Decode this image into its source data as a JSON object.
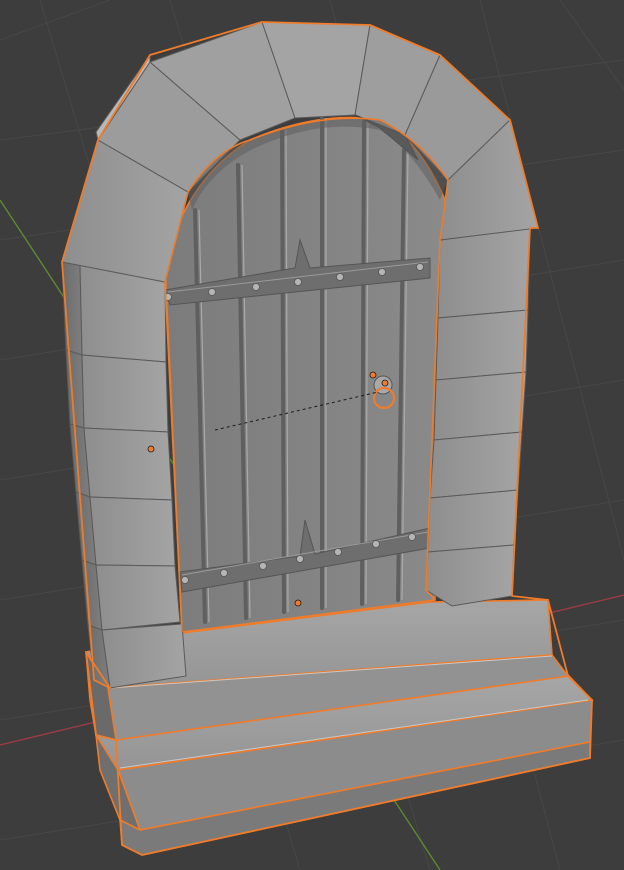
{
  "viewport": {
    "background_color": "#3d3d3d",
    "grid_color": "#4a4a4a",
    "x_axis_color": "#9b3b47",
    "y_axis_color": "#5f8a2e",
    "selection_outline_color": "#f07b2a"
  },
  "scene": {
    "selected_object": "stone-archway-door",
    "parts": [
      "stone-arch",
      "wooden-door",
      "iron-bands",
      "door-ring-knocker",
      "stone-steps"
    ],
    "origin_markers": 3,
    "door_planks": 7,
    "arch_voussoirs": 7
  }
}
